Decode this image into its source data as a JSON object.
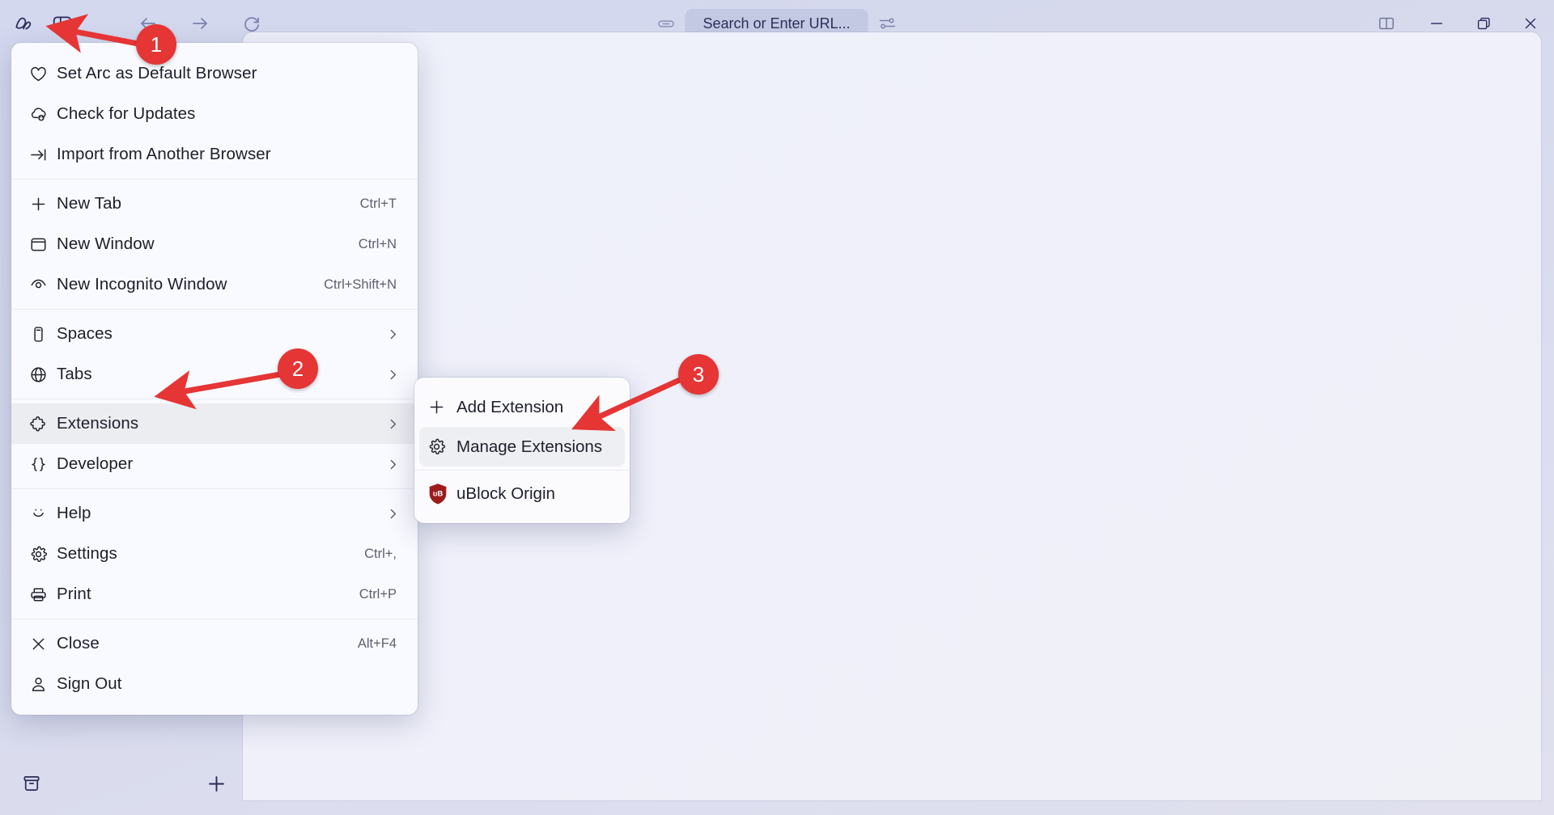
{
  "window": {
    "controls": [
      {
        "name": "split-view",
        "icon": "split-view-icon"
      },
      {
        "name": "minimize",
        "icon": "minimize-icon"
      },
      {
        "name": "maximize",
        "icon": "maximize-icon"
      },
      {
        "name": "close",
        "icon": "close-icon"
      }
    ]
  },
  "toolbar": {
    "arc_logo_icon": "arc-logo-icon",
    "sidebar_toggle_icon": "sidebar-toggle-icon",
    "back_icon": "arrow-left-icon",
    "forward_icon": "arrow-right-icon",
    "reload_icon": "reload-icon",
    "link_icon": "link-icon",
    "sliders_icon": "sliders-icon",
    "url_placeholder": "Search or Enter URL..."
  },
  "sidebar_bottom": {
    "archive_icon": "archive-icon",
    "new_tab_icon": "plus-icon"
  },
  "menu": {
    "groups": [
      {
        "items": [
          {
            "label": "Set Arc as Default Browser",
            "shortcut": "",
            "icon": "heart-icon",
            "chevron": false,
            "selected": false
          },
          {
            "label": "Check for Updates",
            "shortcut": "",
            "icon": "cloud-download-icon",
            "chevron": false,
            "selected": false
          },
          {
            "label": "Import from Another Browser",
            "shortcut": "",
            "icon": "import-arrow-icon",
            "chevron": false,
            "selected": false
          }
        ]
      },
      {
        "items": [
          {
            "label": "New Tab",
            "shortcut": "Ctrl+T",
            "icon": "plus-icon",
            "chevron": false,
            "selected": false
          },
          {
            "label": "New Window",
            "shortcut": "Ctrl+N",
            "icon": "window-icon",
            "chevron": false,
            "selected": false
          },
          {
            "label": "New Incognito Window",
            "shortcut": "Ctrl+Shift+N",
            "icon": "incognito-eye-icon",
            "chevron": false,
            "selected": false
          }
        ]
      },
      {
        "items": [
          {
            "label": "Spaces",
            "shortcut": "",
            "icon": "spaces-icon",
            "chevron": true,
            "selected": false
          },
          {
            "label": "Tabs",
            "shortcut": "",
            "icon": "globe-icon",
            "chevron": true,
            "selected": false
          }
        ]
      },
      {
        "items": [
          {
            "label": "Extensions",
            "shortcut": "",
            "icon": "puzzle-icon",
            "chevron": true,
            "selected": true
          },
          {
            "label": "Developer",
            "shortcut": "",
            "icon": "braces-icon",
            "chevron": true,
            "selected": false
          }
        ]
      },
      {
        "items": [
          {
            "label": "Help",
            "shortcut": "",
            "icon": "smiley-icon",
            "chevron": true,
            "selected": false
          },
          {
            "label": "Settings",
            "shortcut": "Ctrl+,",
            "icon": "gear-icon",
            "chevron": false,
            "selected": false
          },
          {
            "label": "Print",
            "shortcut": "Ctrl+P",
            "icon": "printer-icon",
            "chevron": false,
            "selected": false
          }
        ]
      },
      {
        "items": [
          {
            "label": "Close",
            "shortcut": "Alt+F4",
            "icon": "x-icon",
            "chevron": false,
            "selected": false
          },
          {
            "label": "Sign Out",
            "shortcut": "",
            "icon": "person-icon",
            "chevron": false,
            "selected": false
          }
        ]
      }
    ]
  },
  "submenu": {
    "groups": [
      {
        "items": [
          {
            "label": "Add Extension",
            "icon": "plus-icon",
            "selected": false
          },
          {
            "label": "Manage Extensions",
            "icon": "gear-icon",
            "selected": true
          }
        ]
      },
      {
        "items": [
          {
            "label": "uBlock Origin",
            "icon": "ublock-origin-icon",
            "selected": false
          }
        ]
      }
    ]
  },
  "callouts": [
    {
      "number": "1"
    },
    {
      "number": "2"
    },
    {
      "number": "3"
    }
  ],
  "colors": {
    "callout_red": "#e53535",
    "menu_background": "#f9faff",
    "chrome_background": "#d6d9ec",
    "canvas_background": "#eef0fa",
    "ublock_red": "#a01e1e"
  }
}
